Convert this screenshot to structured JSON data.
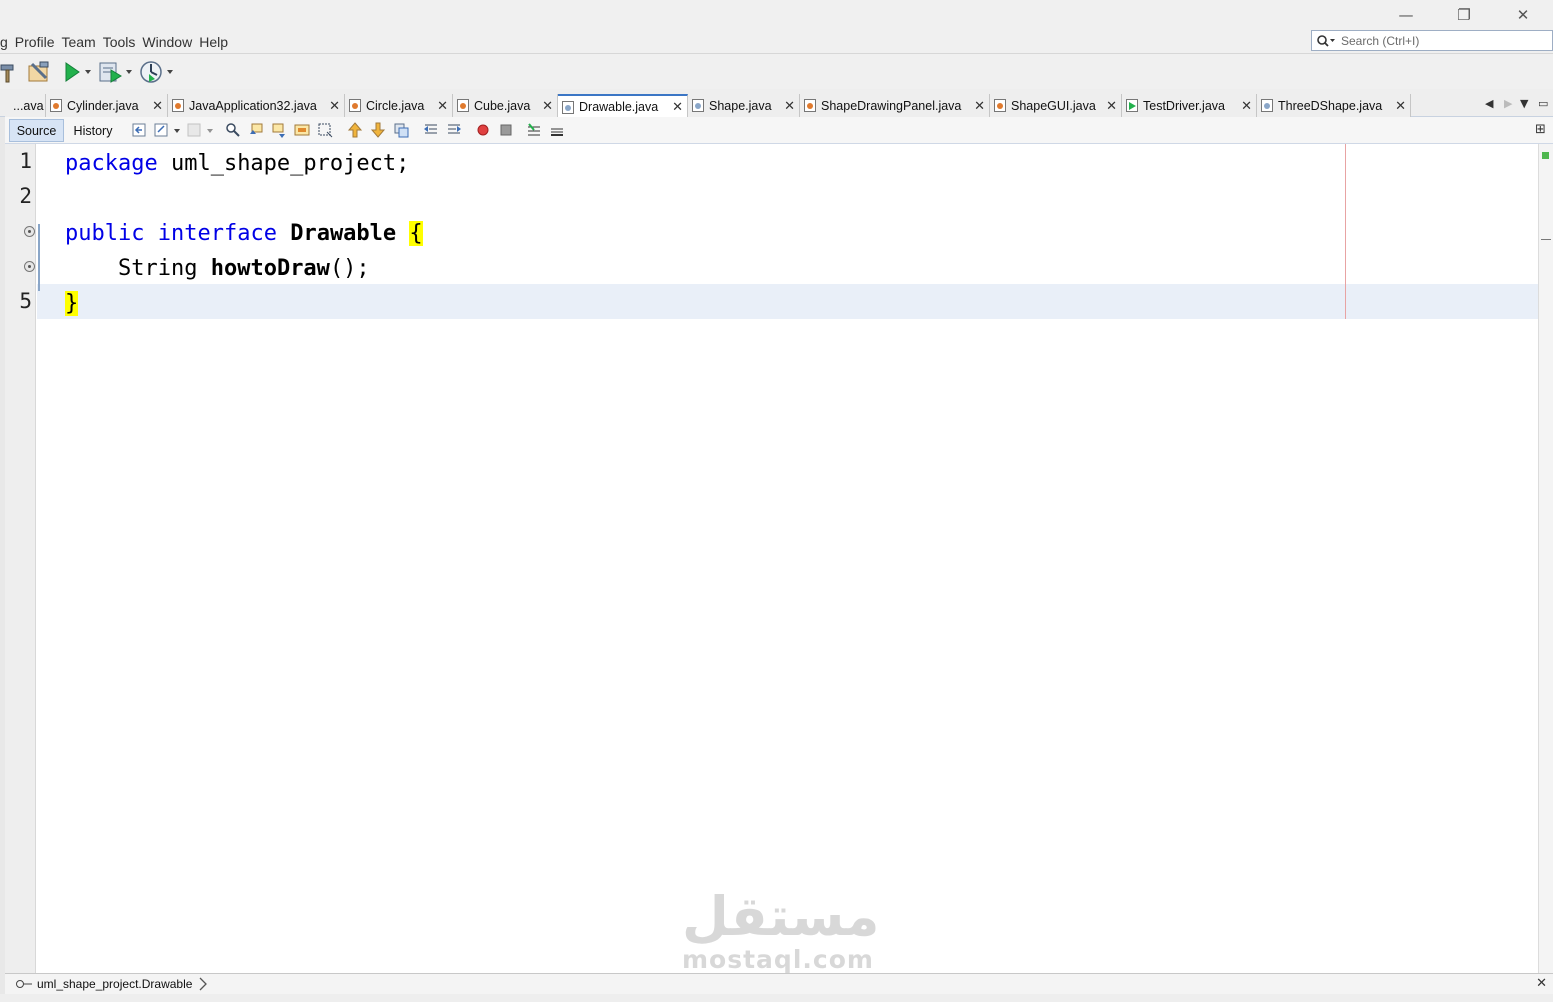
{
  "window": {
    "controls": {
      "minimize": "—",
      "restore": "❐",
      "close": "✕"
    }
  },
  "menu": {
    "items": [
      "g",
      "Profile",
      "Team",
      "Tools",
      "Window",
      "Help"
    ]
  },
  "search": {
    "placeholder": "Search (Ctrl+I)"
  },
  "tabs": [
    {
      "label": "...ava",
      "active": false
    },
    {
      "label": "Cylinder.java",
      "active": false
    },
    {
      "label": "JavaApplication32.java",
      "active": false
    },
    {
      "label": "Circle.java",
      "active": false
    },
    {
      "label": "Cube.java",
      "active": false
    },
    {
      "label": "Drawable.java",
      "active": true
    },
    {
      "label": "Shape.java",
      "active": false
    },
    {
      "label": "ShapeDrawingPanel.java",
      "active": false
    },
    {
      "label": "ShapeGUI.java",
      "active": false
    },
    {
      "label": "TestDriver.java",
      "active": false
    },
    {
      "label": "ThreeDShape.java",
      "active": false
    }
  ],
  "editor_tabs": {
    "source": "Source",
    "history": "History"
  },
  "code": {
    "line_numbers": [
      "1",
      "2",
      "",
      "",
      "5"
    ],
    "line1": {
      "keyword": "package",
      "rest": " uml_shape_project;"
    },
    "line3": {
      "kw1": "public",
      "kw2": "interface",
      "name": "Drawable",
      "brace": "{"
    },
    "line4": {
      "type": "String",
      "method": "howtoDraw",
      "rest": "();"
    },
    "line5": {
      "brace": "}"
    }
  },
  "breadcrumb": "uml_shape_project.Drawable",
  "watermark": {
    "arabic": "مستقل",
    "latin": "mostaql.com"
  },
  "colors": {
    "keyword": "#0000e6",
    "brace_highlight": "#ffff00",
    "current_line": "#e9eff8",
    "active_tab_border": "#3b76c5"
  }
}
